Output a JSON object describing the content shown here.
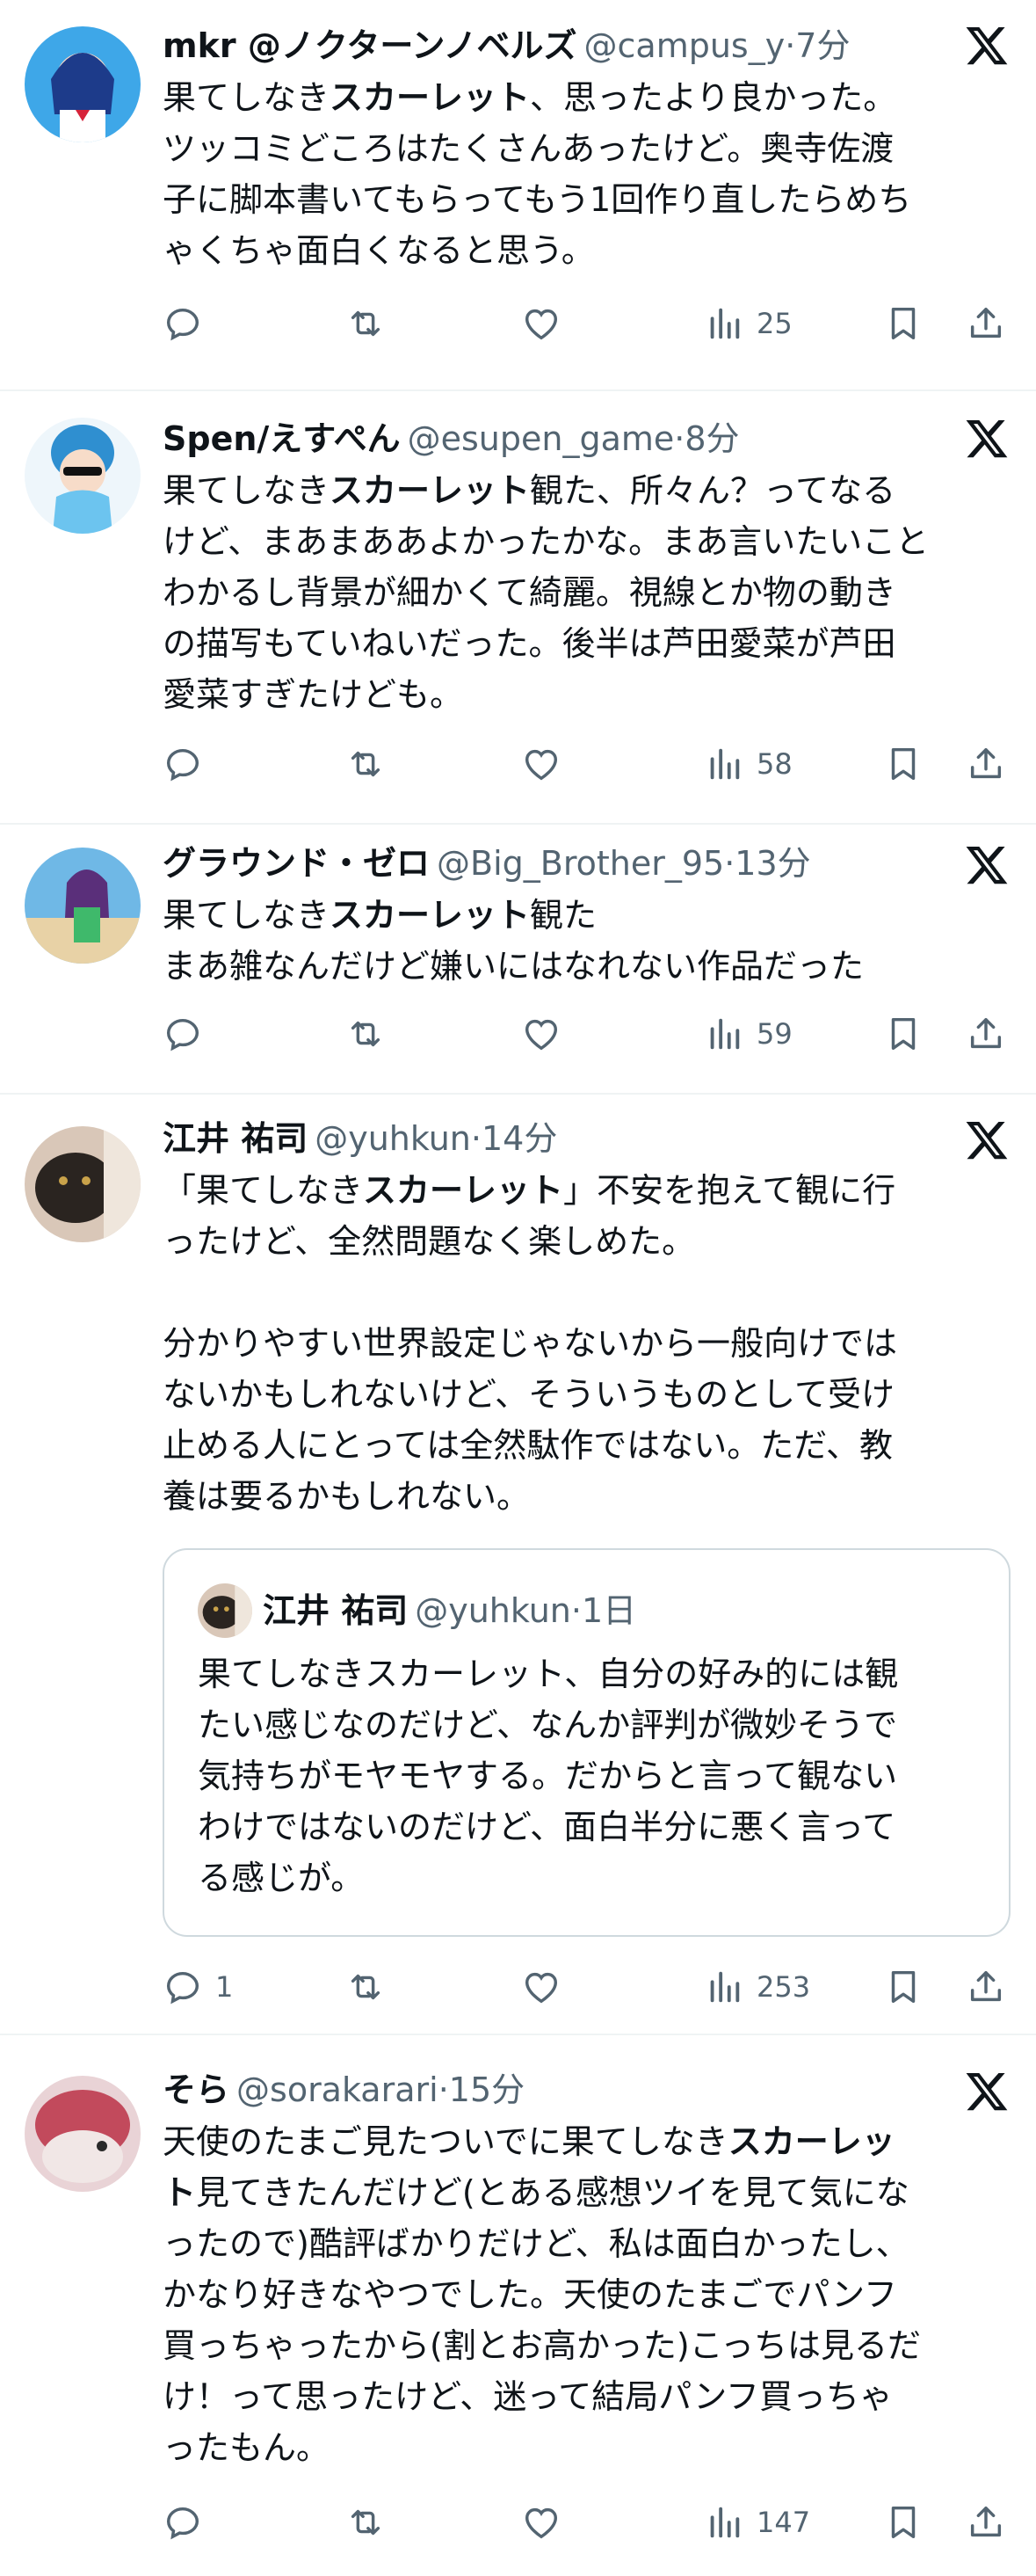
{
  "tweets": [
    {
      "name": "mkr @ノクターンノベルズ",
      "handle": "@campus_y",
      "time": "·7分",
      "lines": [
        {
          "pre": "果てしなき",
          "kw": "スカーレット",
          "post": "、思ったより良かった。"
        },
        {
          "pre": "ツッコミどころはたくさんあったけど。奥寺佐渡",
          "kw": "",
          "post": ""
        },
        {
          "pre": "子に脚本書いてもらってもう1回作り直したらめち",
          "kw": "",
          "post": ""
        },
        {
          "pre": "ゃくちゃ面白くなると思う。",
          "kw": "",
          "post": ""
        }
      ],
      "replies": "",
      "views": "25"
    },
    {
      "name": "Spen/えすぺん",
      "handle": "@esupen_game",
      "time": "·8分",
      "lines": [
        {
          "pre": "果てしなき",
          "kw": "スカーレット",
          "post": "観た、所々ん？ってなる"
        },
        {
          "pre": "けど、まあまああよかったかな。まあ言いたいこと",
          "kw": "",
          "post": ""
        },
        {
          "pre": "わかるし背景が細かくて綺麗。視線とか物の動き",
          "kw": "",
          "post": ""
        },
        {
          "pre": "の描写もていねいだった。後半は芦田愛菜が芦田",
          "kw": "",
          "post": ""
        },
        {
          "pre": "愛菜すぎたけども。",
          "kw": "",
          "post": ""
        }
      ],
      "replies": "",
      "views": "58"
    },
    {
      "name": "グラウンド・ゼロ",
      "handle": "@Big_Brother_95",
      "time": "·13分",
      "lines": [
        {
          "pre": "果てしなき",
          "kw": "スカーレット",
          "post": "観た"
        },
        {
          "pre": "まあ雑なんだけど嫌いにはなれない作品だった",
          "kw": "",
          "post": ""
        }
      ],
      "replies": "",
      "views": "59"
    },
    {
      "name": "江井 祐司",
      "handle": "@yuhkun",
      "time": "·14分",
      "lines": [
        {
          "pre": "「果てしなき",
          "kw": "スカーレット",
          "post": "」不安を抱えて観に行"
        },
        {
          "pre": "ったけど、全然問題なく楽しめた。",
          "kw": "",
          "post": ""
        },
        {
          "pre": "",
          "kw": "",
          "post": ""
        },
        {
          "pre": "分かりやすい世界設定じゃないから一般向けでは",
          "kw": "",
          "post": ""
        },
        {
          "pre": "ないかもしれないけど、そういうものとして受け",
          "kw": "",
          "post": ""
        },
        {
          "pre": "止める人にとっては全然駄作ではない。ただ、教",
          "kw": "",
          "post": ""
        },
        {
          "pre": "養は要るかもしれない。",
          "kw": "",
          "post": ""
        }
      ],
      "quote": {
        "name": "江井 祐司",
        "handle": "@yuhkun",
        "time": "·1日",
        "lines": [
          "果てしなきスカーレット、自分の好み的には観",
          "たい感じなのだけど、なんか評判が微妙そうで",
          "気持ちがモヤモヤする。だからと言って観ない",
          "わけではないのだけど、面白半分に悪く言って",
          "る感じが。"
        ]
      },
      "replies": "1",
      "views": "253"
    },
    {
      "name": "そら",
      "handle": "@sorakarari",
      "time": "·15分",
      "lines": [
        {
          "pre": "天使のたまご見たついでに果てしなき",
          "kw": "スカーレッ",
          "post": ""
        },
        {
          "pre": "",
          "kw": "ト",
          "post": "見てきたんだけど(とある感想ツイを見て気にな"
        },
        {
          "pre": "ったので)酷評ばかりだけど、私は面白かったし、",
          "kw": "",
          "post": ""
        },
        {
          "pre": "かなり好きなやつでした。天使のたまごでパンフ",
          "kw": "",
          "post": ""
        },
        {
          "pre": "買っちゃったから(割とお高かった)こっちは見るだ",
          "kw": "",
          "post": ""
        },
        {
          "pre": "け！って思ったけど、迷って結局パンフ買っちゃ",
          "kw": "",
          "post": ""
        },
        {
          "pre": "ったもん。",
          "kw": "",
          "post": ""
        }
      ],
      "replies": "",
      "views": "147"
    }
  ]
}
